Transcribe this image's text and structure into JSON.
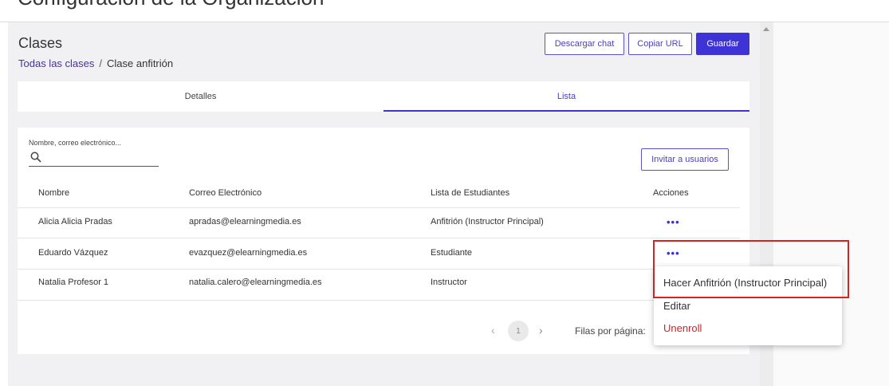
{
  "page": {
    "title": "Configuración de la Organización"
  },
  "section": {
    "title": "Clases"
  },
  "breadcrumb": {
    "link": "Todas las clases",
    "separator": "/",
    "current": "Clase anfitrión"
  },
  "toolbar": {
    "download_label": "Descargar chat",
    "copy_label": "Copiar URL",
    "save_label": "Guardar"
  },
  "tabs": [
    {
      "label": "Detalles"
    },
    {
      "label": "Lista"
    }
  ],
  "search": {
    "label": "Nombre, correo electrónico..."
  },
  "invite_label": "Invitar a usuarios",
  "table": {
    "headers": [
      "Nombre",
      "Correo Electrónico",
      "Lista de Estudiantes",
      "Acciones"
    ],
    "rows": [
      {
        "name": "Alicia Alicia Pradas",
        "email": "apradas@elearningmedia.es",
        "role": "Anfitrión (Instructor Principal)",
        "actions": "•••"
      },
      {
        "name": "Eduardo Vázquez",
        "email": "evazquez@elearningmedia.es",
        "role": "Estudiante",
        "actions": "•••"
      },
      {
        "name": "Natalia Profesor 1",
        "email": "natalia.calero@elearningmedia.es",
        "role": "Instructor",
        "actions": ""
      }
    ]
  },
  "pagination": {
    "prev": "‹",
    "page": "1",
    "next": "›",
    "rows_per_page_label": "Filas por página:"
  },
  "context_menu": {
    "items": [
      {
        "label": "Hacer Anfitrión (Instructor Principal)"
      },
      {
        "label": "Editar"
      },
      {
        "label": "Unenroll"
      }
    ]
  },
  "colors": {
    "accent": "#3d33d6",
    "danger": "#d0232a",
    "highlight": "#d9211f"
  }
}
